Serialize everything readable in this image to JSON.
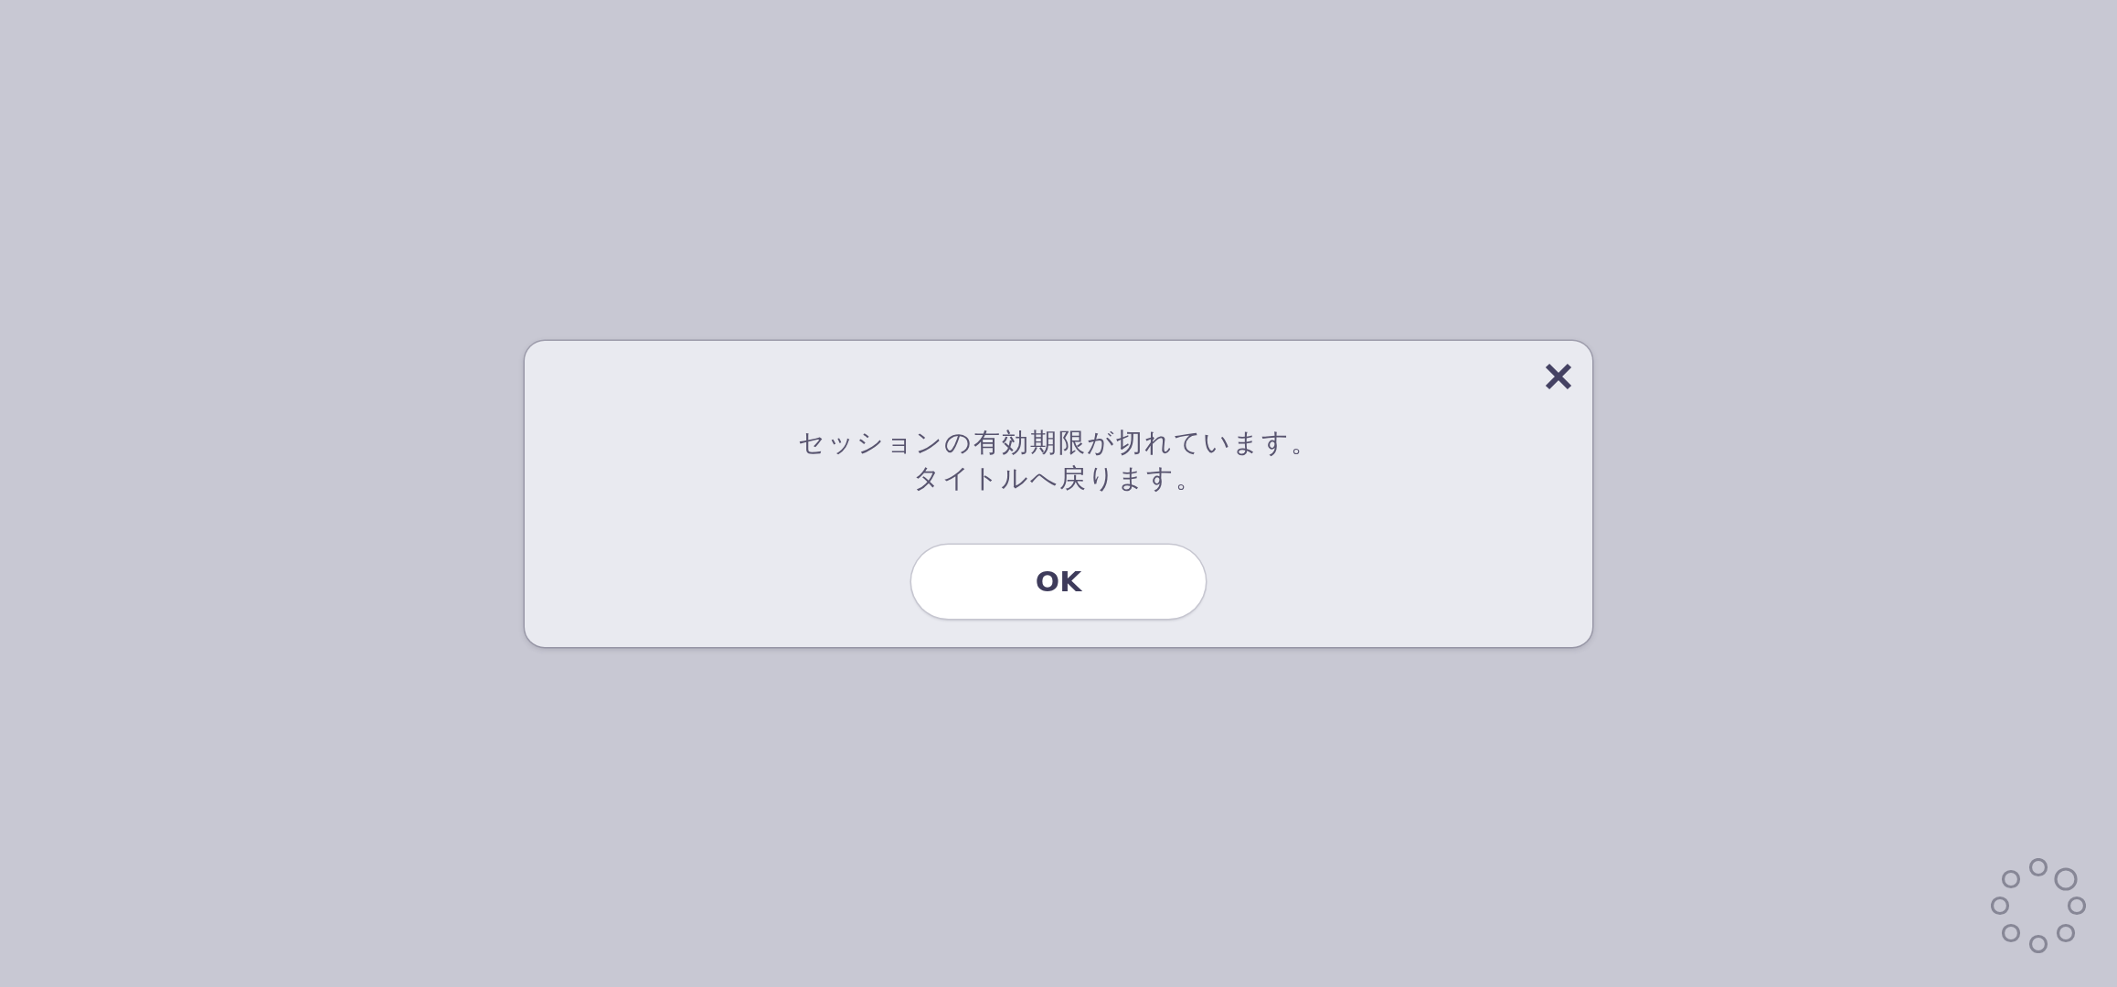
{
  "dialog": {
    "message_lines": [
      "セッションの有効期限が切れています。",
      "タイトルへ戻ります。"
    ],
    "buttons": [
      {
        "label": "OK"
      }
    ]
  }
}
